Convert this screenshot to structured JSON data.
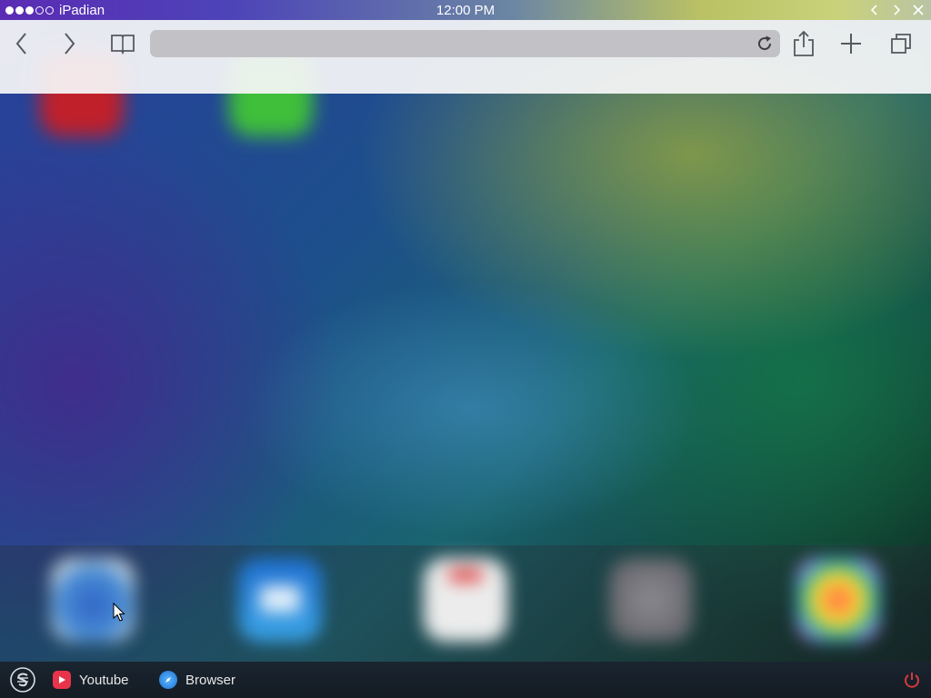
{
  "statusbar": {
    "carrier": "iPadian",
    "time": "12:00 PM",
    "signal_bars": 5,
    "signal_filled": 3,
    "window_controls": [
      "chevron-left-icon",
      "chevron-right-icon",
      "close-icon"
    ]
  },
  "toolbar": {
    "buttons": [
      "back-icon",
      "forward-icon",
      "bookmarks-book-icon",
      "share-icon",
      "new-tab-plus-icon",
      "tabs-icon"
    ],
    "url": "",
    "url_placeholder": "",
    "reload_icon": "reload-icon"
  },
  "home_screen": {
    "top_apps": [
      {
        "icon": "app-icon-red",
        "color": "#c0202a"
      },
      {
        "icon": "app-icon-green",
        "color": "#3fbf3a"
      }
    ],
    "dock_apps": [
      {
        "icon": "safari-app-icon",
        "color": "#3d78c8"
      },
      {
        "icon": "mail-app-icon",
        "color": "#2b7fd8"
      },
      {
        "icon": "calendar-app-icon",
        "color": "#e6e6e6"
      },
      {
        "icon": "settings-app-icon",
        "color": "#6b6b70"
      },
      {
        "icon": "photos-app-icon",
        "color": "#f2f2f2"
      }
    ]
  },
  "taskbar": {
    "start_icon": "ipadian-start-icon",
    "items": [
      {
        "label": "Youtube",
        "icon": "youtube-icon",
        "color": "#e8344a"
      },
      {
        "label": "Browser",
        "icon": "browser-compass-icon",
        "color": "#1e88e5"
      }
    ],
    "power_icon": "power-icon",
    "power_color": "#d63a3a"
  },
  "colors": {
    "statusbar_left": "#5a2bb4",
    "statusbar_right": "#c9d27a",
    "toolbar_bg": "#f6f6f8",
    "url_bar": "#c2c2c6",
    "taskbar_bg": "#1a2530"
  }
}
